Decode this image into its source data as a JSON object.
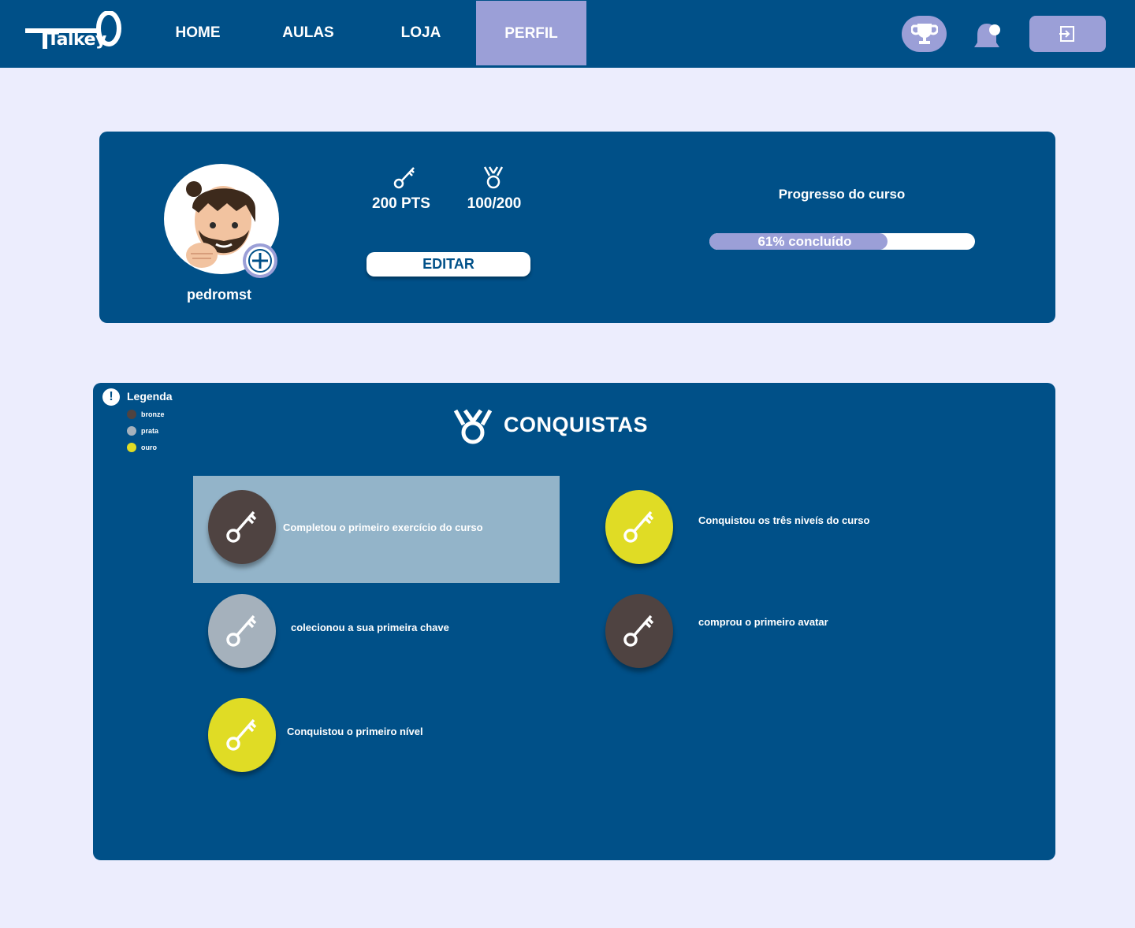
{
  "app": {
    "logo_text": "Talkey"
  },
  "nav": {
    "links": [
      {
        "label": "HOME"
      },
      {
        "label": "AULAS"
      },
      {
        "label": "LOJA"
      },
      {
        "label": "PERFIL",
        "active": true
      }
    ],
    "trophy_icon": "trophy-icon",
    "bell_icon": "bell-icon",
    "logout_icon": "logout-icon"
  },
  "profile": {
    "username": "pedromst",
    "points": "200 PTS",
    "medals": "100/200",
    "edit_label": "EDITAR",
    "progress_title": "Progresso do curso",
    "progress_label": "61% concluído",
    "progress_fraction": 0.67
  },
  "achievements": {
    "legend_title": "Legenda",
    "legend": [
      {
        "label": "bronze",
        "color": "#4f4341"
      },
      {
        "label": "prata",
        "color": "#a5b1bc"
      },
      {
        "label": "ouro",
        "color": "#e0dc25"
      }
    ],
    "title": "CONQUISTAS",
    "items": [
      {
        "label": "Completou o primeiro exercício do curso",
        "tier": "bronze",
        "color": "#4f4341",
        "highlighted": true
      },
      {
        "label": "Conquistou os três niveís do curso",
        "tier": "ouro",
        "color": "#e0dc25"
      },
      {
        "label": "colecionou a sua primeira chave",
        "tier": "prata",
        "color": "#a5b1bc"
      },
      {
        "label": "comprou o primeiro avatar",
        "tier": "bronze",
        "color": "#4f4341"
      },
      {
        "label": "Conquistou o primeiro nível",
        "tier": "ouro",
        "color": "#e0dc25"
      }
    ]
  },
  "colors": {
    "primary": "#005088",
    "accent": "#9b9fd7",
    "background": "#ecedfd",
    "highlight": "#93b4c9"
  }
}
